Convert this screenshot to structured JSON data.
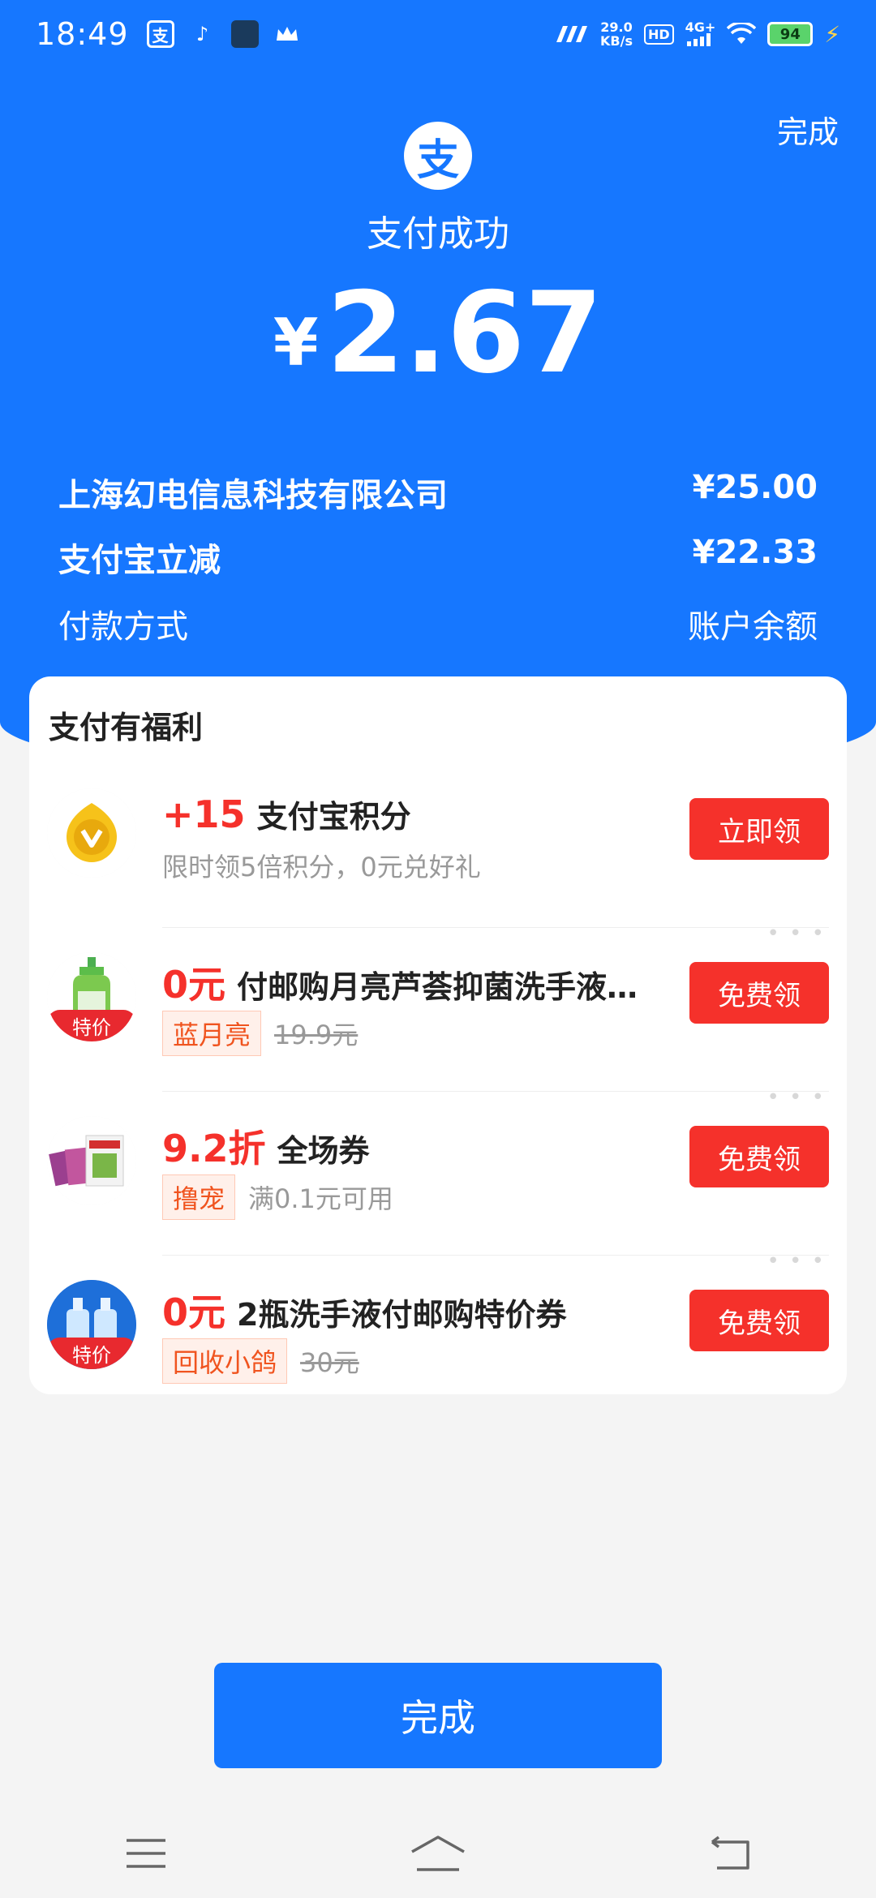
{
  "status_bar": {
    "time": "18:49",
    "net_speed_value": "29.0",
    "net_speed_unit": "KB/s",
    "hd": "HD",
    "network": "4G+",
    "battery": "94"
  },
  "header": {
    "done_label": "完成",
    "logo_glyph": "支",
    "status": "支付成功",
    "currency": "¥",
    "amount": "2.67"
  },
  "details": [
    {
      "label": "上海幻电信息科技有限公司",
      "value": "¥25.00"
    },
    {
      "label": "支付宝立减",
      "value": "¥22.33"
    },
    {
      "label": "付款方式",
      "value": "账户余额"
    }
  ],
  "benefits": {
    "title": "支付有福利",
    "items": [
      {
        "highlight": "+15",
        "title": "支付宝积分",
        "sub": "限时领5倍积分，0元兑好礼",
        "tag": "",
        "old_price": "",
        "button": "立即领",
        "special": ""
      },
      {
        "highlight": "0元",
        "title": "付邮购月亮芦荟抑菌洗手液…",
        "sub": "",
        "tag": "蓝月亮",
        "old_price": "19.9元",
        "button": "免费领",
        "special": "特价"
      },
      {
        "highlight": "9.2折",
        "title": "全场券",
        "sub": "满0.1元可用",
        "tag": "撸宠",
        "old_price": "",
        "button": "免费领",
        "special": ""
      },
      {
        "highlight": "0元",
        "title": "2瓶洗手液付邮购特价券",
        "sub": "",
        "tag": "回收小鸽",
        "old_price": "30元",
        "button": "免费领",
        "special": "特价"
      }
    ]
  },
  "footer": {
    "done_label": "完成"
  },
  "colors": {
    "primary": "#1677ff",
    "accent_red": "#f5312b"
  }
}
